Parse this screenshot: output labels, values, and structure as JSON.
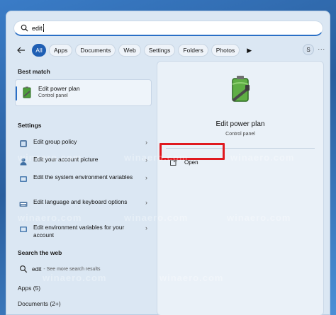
{
  "search": {
    "query": "edit"
  },
  "filters": [
    "All",
    "Apps",
    "Documents",
    "Web",
    "Settings",
    "Folders",
    "Photos"
  ],
  "account_initial": "S",
  "more": "...",
  "sections": {
    "best_match": "Best match",
    "settings": "Settings",
    "search_web": "Search the web",
    "apps": "Apps (5)",
    "documents": "Documents (2+)"
  },
  "best_match": {
    "title": "Edit power plan",
    "subtitle": "Control panel"
  },
  "settings_items": [
    "Edit group policy",
    "Edit your account picture",
    "Edit the system environment variables",
    "Edit language and keyboard options",
    "Edit environment variables for your account"
  ],
  "web_item": {
    "query": "edit",
    "hint": "- See more search results"
  },
  "detail": {
    "title": "Edit power plan",
    "subtitle": "Control panel",
    "open_label": "Open"
  },
  "watermark": "winaero.com",
  "colors": {
    "accent": "#1f5fb4",
    "highlight": "#e0191f"
  }
}
